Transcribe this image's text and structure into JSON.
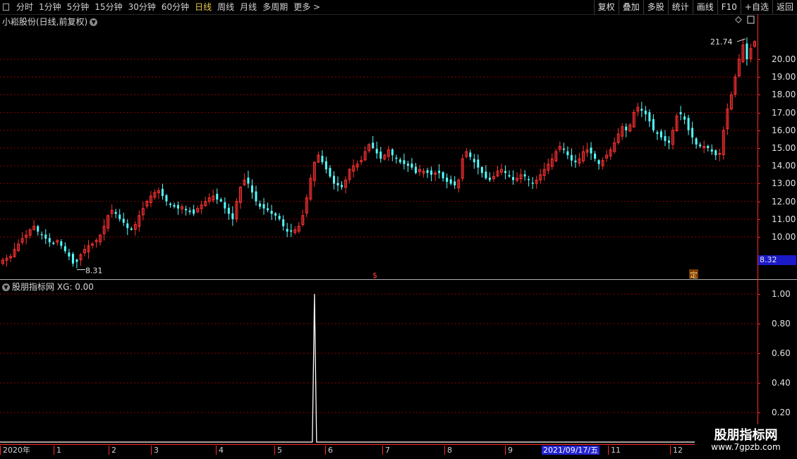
{
  "toolbar": {
    "periods": [
      "分时",
      "1分钟",
      "5分钟",
      "15分钟",
      "30分钟",
      "60分钟",
      "日线",
      "周线",
      "月线",
      "多周期",
      "更多 >"
    ],
    "active_period": "日线",
    "right_buttons": [
      "复权",
      "叠加",
      "多股",
      "统计",
      "画线",
      "F10",
      "+自选",
      "返回"
    ]
  },
  "main_chart": {
    "title": "小崧股份(日线,前复权)",
    "low_label": "8.31",
    "high_label": "21.74",
    "current_price": "8.32",
    "marker_dollar": "$",
    "marker_ding": "定",
    "colors": {
      "up": "#ff3232",
      "down": "#54ffff",
      "grid": "#8b0000",
      "axis": "#ff2a2a"
    }
  },
  "indicator": {
    "title": "股朋指标网",
    "readout": "XG: 0.00"
  },
  "chart_data": [
    {
      "type": "candlestick",
      "y_ticks": [
        "20.00",
        "19.00",
        "18.00",
        "17.00",
        "16.00",
        "15.00",
        "14.00",
        "13.00",
        "12.00",
        "11.00",
        "10.00"
      ],
      "ylim": [
        8.0,
        22.0
      ],
      "close_series": [
        8.7,
        8.8,
        8.9,
        9.3,
        9.6,
        9.9,
        10.1,
        10.4,
        10.6,
        10.3,
        10.1,
        9.9,
        9.7,
        9.6,
        9.8,
        9.5,
        9.2,
        8.9,
        8.5,
        8.6,
        9.0,
        9.3,
        9.5,
        9.6,
        9.8,
        10.1,
        10.6,
        11.2,
        11.5,
        11.3,
        11.0,
        10.8,
        10.5,
        10.4,
        10.7,
        11.2,
        11.6,
        12.0,
        12.3,
        12.5,
        12.6,
        12.3,
        12.0,
        11.8,
        11.7,
        11.6,
        11.7,
        11.5,
        11.4,
        11.3,
        11.6,
        11.8,
        12.0,
        12.2,
        12.3,
        12.1,
        12.0,
        11.6,
        11.3,
        11.0,
        12.0,
        12.8,
        13.2,
        13.0,
        12.5,
        12.0,
        11.7,
        11.6,
        11.5,
        11.3,
        11.2,
        11.0,
        10.6,
        10.3,
        10.3,
        10.4,
        10.6,
        11.2,
        12.2,
        13.3,
        14.2,
        14.6,
        14.2,
        13.8,
        13.4,
        13.0,
        12.9,
        12.8,
        13.2,
        13.8,
        14.0,
        14.1,
        14.3,
        14.8,
        15.2,
        15.0,
        14.7,
        14.4,
        14.6,
        14.9,
        14.6,
        14.4,
        14.2,
        14.1,
        14.0,
        13.9,
        13.6,
        13.8,
        13.7,
        13.6,
        13.5,
        13.6,
        13.6,
        13.3,
        13.1,
        13.0,
        12.9,
        13.2,
        14.4,
        14.8,
        14.5,
        14.2,
        13.9,
        13.6,
        13.3,
        13.2,
        13.4,
        13.7,
        13.8,
        13.6,
        13.4,
        13.2,
        13.3,
        13.5,
        13.4,
        13.2,
        13.0,
        13.2,
        13.5,
        13.8,
        14.1,
        14.4,
        14.8,
        15.1,
        14.9,
        14.6,
        14.3,
        14.2,
        14.4,
        14.8,
        14.9,
        14.7,
        14.4,
        14.1,
        14.3,
        14.6,
        14.9,
        15.3,
        15.8,
        16.2,
        16.0,
        16.3,
        17.0,
        17.3,
        17.1,
        16.9,
        16.5,
        16.0,
        15.8,
        15.6,
        15.4,
        15.3,
        16.0,
        16.8,
        16.9,
        16.6,
        16.0,
        15.6,
        15.2,
        15.1,
        15.1,
        15.0,
        14.8,
        14.6,
        14.7,
        16.0,
        17.2,
        18.0,
        19.0,
        20.0,
        20.8,
        20.0,
        20.6,
        21.0
      ]
    },
    {
      "type": "line",
      "name": "XG",
      "y_ticks": [
        "1.00",
        "0.80",
        "0.60",
        "0.40",
        "0.20"
      ],
      "ylim": [
        0,
        1.0
      ],
      "spike_day_index": 80,
      "spike_value": 1.0
    }
  ],
  "x_axis": {
    "labels": [
      "2020年",
      "1",
      "2",
      "3",
      "4",
      "5",
      "6",
      "7",
      "8",
      "9",
      "11",
      "12"
    ],
    "cursor": "2021/09/17/五"
  },
  "watermark": {
    "line1": "股朋指标网",
    "line2": "www.7gpzb.com"
  }
}
